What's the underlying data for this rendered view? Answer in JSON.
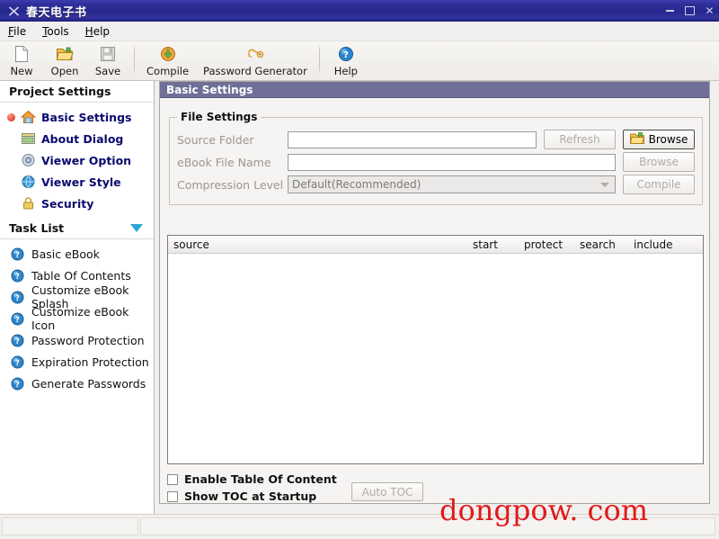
{
  "window": {
    "title": "春天电子书",
    "icon": "app-icon",
    "buttons": {
      "minimize": "minimize-icon",
      "maximize": "maximize-icon",
      "close": "close-icon"
    }
  },
  "menubar": {
    "items": [
      {
        "label": "File",
        "mnemonic": "F"
      },
      {
        "label": "Tools",
        "mnemonic": "T"
      },
      {
        "label": "Help",
        "mnemonic": "H"
      }
    ]
  },
  "toolbar": {
    "items": [
      {
        "label": "New",
        "icon": "new-document-icon"
      },
      {
        "label": "Open",
        "icon": "open-folder-icon"
      },
      {
        "label": "Save",
        "icon": "save-disk-icon"
      },
      {
        "label": "Compile",
        "icon": "compile-icon"
      },
      {
        "label": "Password Generator",
        "icon": "password-key-icon"
      },
      {
        "label": "Help",
        "icon": "help-question-icon"
      }
    ]
  },
  "sidebar": {
    "project_settings": {
      "header": "Project Settings",
      "items": [
        {
          "label": "Basic Settings",
          "icon": "home-icon",
          "selected": true
        },
        {
          "label": "About Dialog",
          "icon": "about-dialog-icon",
          "selected": false
        },
        {
          "label": "Viewer Option",
          "icon": "viewer-option-icon",
          "selected": false
        },
        {
          "label": "Viewer Style",
          "icon": "globe-icon",
          "selected": false
        },
        {
          "label": "Security",
          "icon": "lock-icon",
          "selected": false
        }
      ]
    },
    "task_list": {
      "header": "Task List",
      "collapse_icon": "triangle-down-icon",
      "items": [
        {
          "label": "Basic eBook",
          "icon": "info-icon"
        },
        {
          "label": "Table Of Contents",
          "icon": "info-icon"
        },
        {
          "label": "Customize eBook Splash",
          "icon": "info-icon"
        },
        {
          "label": "Customize eBook Icon",
          "icon": "info-icon"
        },
        {
          "label": "Password Protection",
          "icon": "info-icon"
        },
        {
          "label": "Expiration Protection",
          "icon": "info-icon"
        },
        {
          "label": "Generate Passwords",
          "icon": "info-icon"
        }
      ]
    }
  },
  "main": {
    "panel_title": "Basic Settings",
    "file_settings": {
      "legend": "File Settings",
      "source_folder": {
        "label": "Source Folder",
        "value": "",
        "placeholder": "",
        "refresh_button": "Refresh",
        "browse_button": "Browse",
        "browse_icon": "browse-folder-icon"
      },
      "ebook_file_name": {
        "label": "eBook File Name",
        "value": "",
        "placeholder": "",
        "browse_button": "Browse"
      },
      "compression_level": {
        "label": "Compression Level",
        "value": "Default(Recommended)",
        "compile_button": "Compile"
      }
    },
    "source_list": {
      "columns": [
        "source",
        "start",
        "protect",
        "search",
        "include"
      ],
      "rows": []
    },
    "toc_options": {
      "enable_toc": {
        "label": "Enable Table Of Content",
        "checked": false
      },
      "show_toc_startup": {
        "label": "Show TOC at Startup",
        "checked": false
      },
      "auto_toc_button": "Auto TOC"
    }
  },
  "statusbar": {
    "left_text": "",
    "right_text": ""
  },
  "watermark": {
    "text": "dongpow. com",
    "color": "#e11a1a"
  },
  "colors": {
    "titlebar": "#2f2f99",
    "panel_header": "#6f6f99",
    "sidebar_link": "#0a0a6e",
    "accent_triangle": "#2ea7d8"
  }
}
